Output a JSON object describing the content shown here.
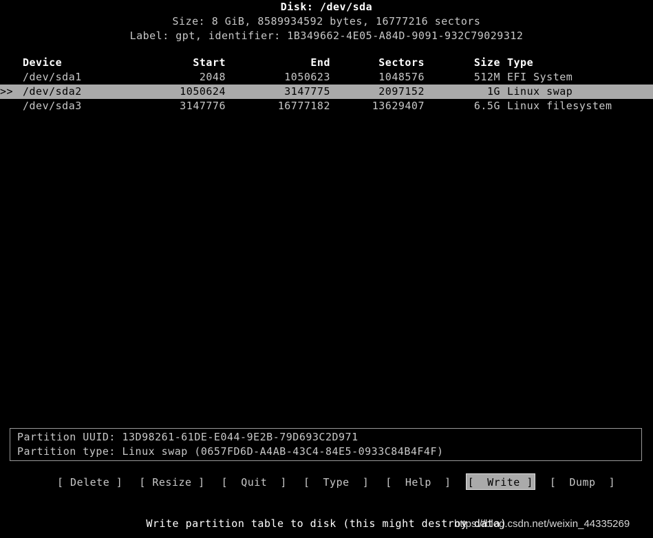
{
  "header": {
    "title": "Disk: /dev/sda",
    "size_line": "Size: 8 GiB, 8589934592 bytes, 16777216 sectors",
    "label_line": "Label: gpt, identifier: 1B349662-4E05-A84D-9091-932C79029312"
  },
  "table": {
    "columns": [
      "Device",
      "Start",
      "End",
      "Sectors",
      "Size",
      "Type"
    ],
    "headers": {
      "device": "Device",
      "start": "Start",
      "end": "End",
      "sectors": "Sectors",
      "size": "Size",
      "type": "Type"
    },
    "selection_marker": ">>",
    "rows": [
      {
        "marker": "",
        "device": "/dev/sda1",
        "start": "2048",
        "end": "1050623",
        "sectors": "1048576",
        "size": "512M",
        "type": "EFI System",
        "selected": false
      },
      {
        "marker": ">>",
        "device": "/dev/sda2",
        "start": "1050624",
        "end": "3147775",
        "sectors": "2097152",
        "size": "1G",
        "type": "Linux swap",
        "selected": true
      },
      {
        "marker": "",
        "device": "/dev/sda3",
        "start": "3147776",
        "end": "16777182",
        "sectors": "13629407",
        "size": "6.5G",
        "type": "Linux filesystem",
        "selected": false
      }
    ]
  },
  "info": {
    "uuid_line": "Partition UUID: 13D98261-61DE-E044-9E2B-79D693C2D971",
    "type_line": "Partition type: Linux swap (0657FD6D-A4AB-43C4-84E5-0933C84B4F4F)"
  },
  "menu": {
    "items": [
      {
        "label": "[ Delete ]",
        "name": "delete",
        "active": false
      },
      {
        "label": "[ Resize ]",
        "name": "resize",
        "active": false
      },
      {
        "label": "[  Quit  ]",
        "name": "quit",
        "active": false
      },
      {
        "label": "[  Type  ]",
        "name": "type",
        "active": false
      },
      {
        "label": "[  Help  ]",
        "name": "help",
        "active": false
      },
      {
        "label": "[  Write ]",
        "name": "write",
        "active": true
      },
      {
        "label": "[  Dump  ]",
        "name": "dump",
        "active": false
      }
    ]
  },
  "status": {
    "text": "Write partition table to disk (this might destroy data)"
  },
  "watermark": {
    "text": "https://blog.csdn.net/weixin_44335269"
  },
  "colors": {
    "background": "#000000",
    "foreground": "#c8c8c8",
    "bright": "#ffffff",
    "highlight_bg": "#aaaaaa",
    "highlight_fg": "#000000",
    "border": "#9a9a9a"
  }
}
